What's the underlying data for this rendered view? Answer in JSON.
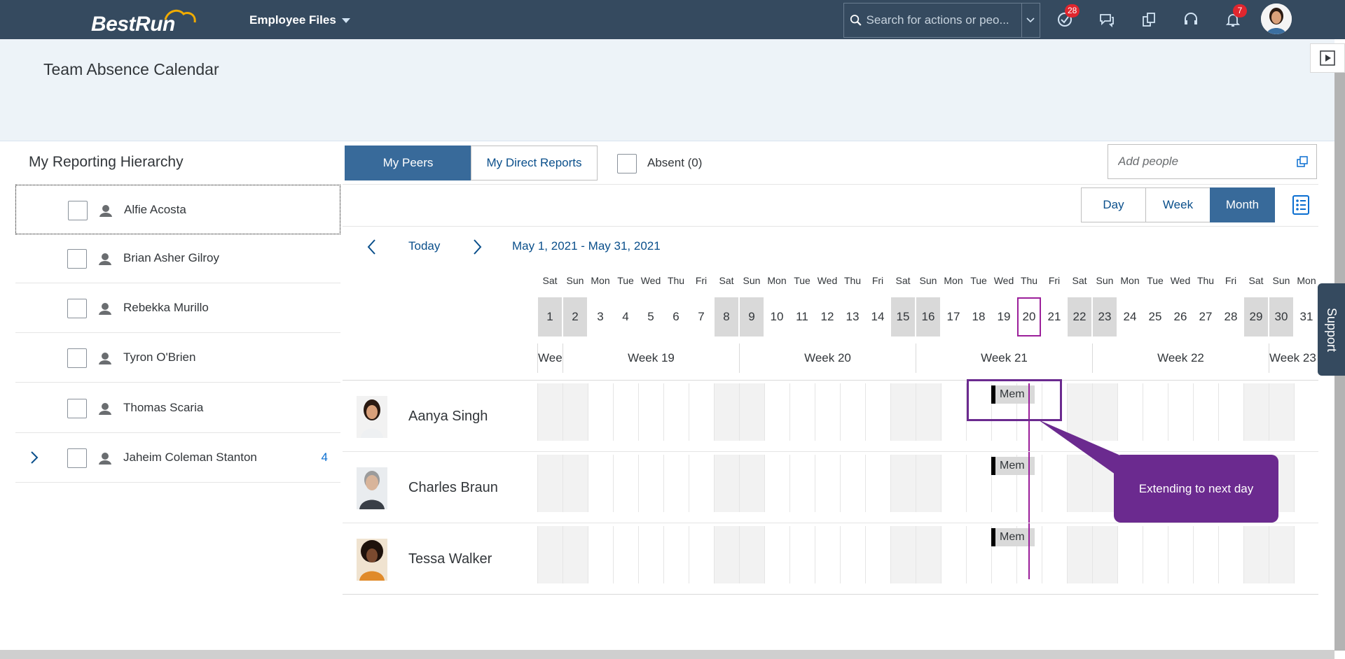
{
  "shell": {
    "logo_text": "BestRun",
    "app_title": "Employee Files",
    "search_placeholder": "Search for actions or peo...",
    "todo_badge": "28",
    "notification_badge": "7",
    "accent": "#354a5f"
  },
  "page": {
    "title": "Team Absence Calendar"
  },
  "hierarchy": {
    "title": "My Reporting Hierarchy",
    "items": [
      {
        "name": "Alfie Acosta",
        "count": ""
      },
      {
        "name": "Brian Asher Gilroy",
        "count": ""
      },
      {
        "name": "Rebekka Murillo",
        "count": ""
      },
      {
        "name": "Tyron O'Brien",
        "count": ""
      },
      {
        "name": "Thomas Scaria",
        "count": ""
      },
      {
        "name": "Jaheim Coleman Stanton",
        "count": "4"
      }
    ]
  },
  "toolbar": {
    "tab_peers": "My Peers",
    "tab_direct": "My Direct Reports",
    "absent_label": "Absent (0)",
    "add_people_placeholder": "Add people",
    "view_day": "Day",
    "view_week": "Week",
    "view_month": "Month"
  },
  "nav": {
    "today": "Today",
    "range": "May 1, 2021 - May 31, 2021"
  },
  "calendar": {
    "days": [
      {
        "dow": "Sat",
        "num": "1"
      },
      {
        "dow": "Sun",
        "num": "2"
      },
      {
        "dow": "Mon",
        "num": "3"
      },
      {
        "dow": "Tue",
        "num": "4"
      },
      {
        "dow": "Wed",
        "num": "5"
      },
      {
        "dow": "Thu",
        "num": "6"
      },
      {
        "dow": "Fri",
        "num": "7"
      },
      {
        "dow": "Sat",
        "num": "8"
      },
      {
        "dow": "Sun",
        "num": "9"
      },
      {
        "dow": "Mon",
        "num": "10"
      },
      {
        "dow": "Tue",
        "num": "11"
      },
      {
        "dow": "Wed",
        "num": "12"
      },
      {
        "dow": "Thu",
        "num": "13"
      },
      {
        "dow": "Fri",
        "num": "14"
      },
      {
        "dow": "Sat",
        "num": "15"
      },
      {
        "dow": "Sun",
        "num": "16"
      },
      {
        "dow": "Mon",
        "num": "17"
      },
      {
        "dow": "Tue",
        "num": "18"
      },
      {
        "dow": "Wed",
        "num": "19"
      },
      {
        "dow": "Thu",
        "num": "20"
      },
      {
        "dow": "Fri",
        "num": "21"
      },
      {
        "dow": "Sat",
        "num": "22"
      },
      {
        "dow": "Sun",
        "num": "23"
      },
      {
        "dow": "Mon",
        "num": "24"
      },
      {
        "dow": "Tue",
        "num": "25"
      },
      {
        "dow": "Wed",
        "num": "26"
      },
      {
        "dow": "Thu",
        "num": "27"
      },
      {
        "dow": "Fri",
        "num": "28"
      },
      {
        "dow": "Sat",
        "num": "29"
      },
      {
        "dow": "Sun",
        "num": "30"
      },
      {
        "dow": "Mon",
        "num": "31"
      }
    ],
    "today_index": 19,
    "weeks": [
      {
        "label": "Wee",
        "days": 1
      },
      {
        "label": "Week 19",
        "days": 7
      },
      {
        "label": "Week 20",
        "days": 7
      },
      {
        "label": "Week 21",
        "days": 7
      },
      {
        "label": "Week 22",
        "days": 7
      },
      {
        "label": "Week 23",
        "days": 2
      }
    ],
    "today_color": "#9b1f9a"
  },
  "people": [
    {
      "name": "Aanya Singh",
      "absence": "Mem"
    },
    {
      "name": "Charles Braun",
      "absence": "Mem"
    },
    {
      "name": "Tessa Walker",
      "absence": "Mem"
    }
  ],
  "callout": {
    "text": "Extending to next day",
    "color": "#6b2a8f"
  },
  "support": {
    "label": "Support"
  }
}
